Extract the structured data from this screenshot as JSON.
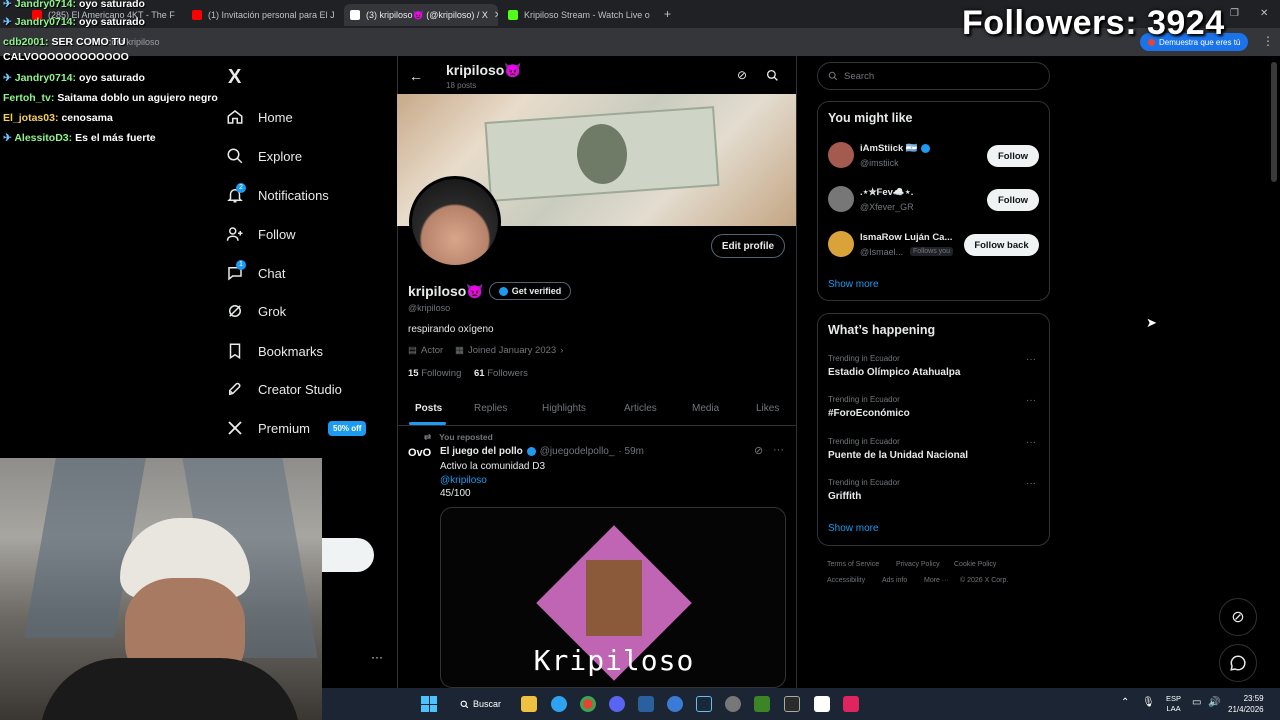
{
  "overlay": {
    "followers_text": "Followers: 3924"
  },
  "browser": {
    "tabs": [
      {
        "label": "(285) El Americano 4KT - The F",
        "color": "#ff0000"
      },
      {
        "label": "(1) Invitación personal para El J",
        "color": "#ff0000"
      },
      {
        "label": "(3) kripiloso👿 (@kripiloso) / X",
        "color": "#ffffff"
      },
      {
        "label": "Kripiloso Stream - Watch Live o",
        "color": "#53fc18"
      }
    ],
    "url": "x.com/kripiloso",
    "verify_label": "Demuestra que eres tú"
  },
  "chat": [
    {
      "user": "Jandry0714:",
      "msg": "oyo saturado",
      "color": "#8ef58a",
      "badge": true
    },
    {
      "user": "Jandry0714:",
      "msg": "oyo saturado",
      "color": "#8ef58a",
      "badge": true
    },
    {
      "user": "cdb2001:",
      "msg": "SER COMO TU",
      "color": "#8ef58a",
      "badge": false
    },
    {
      "user": "",
      "msg": "CALVOOOOOOOOOOOO",
      "color": "#ffffff",
      "badge": false
    },
    {
      "user": "Jandry0714:",
      "msg": "oyo saturado",
      "color": "#8ef58a",
      "badge": true
    },
    {
      "user": "Fertoh_tv:",
      "msg": "Saitama doblo un agujero negro",
      "color": "#8ef58a",
      "badge": false
    },
    {
      "user": "El_jotas03:",
      "msg": "cenosama",
      "color": "#f5d05a",
      "badge": false
    },
    {
      "user": "AlessitoD3:",
      "msg": "Es el más fuerte",
      "color": "#8ef58a",
      "badge": true
    }
  ],
  "sidebar": {
    "logo": "X",
    "items": [
      {
        "label": "Home",
        "icon": "home-icon"
      },
      {
        "label": "Explore",
        "icon": "search-icon"
      },
      {
        "label": "Notifications",
        "icon": "bell-icon",
        "badge": "2"
      },
      {
        "label": "Follow",
        "icon": "person-add-icon"
      },
      {
        "label": "Chat",
        "icon": "chat-icon",
        "badge": "1"
      },
      {
        "label": "Grok",
        "icon": "grok-icon"
      },
      {
        "label": "Bookmarks",
        "icon": "bookmark-icon"
      },
      {
        "label": "Creator Studio",
        "icon": "rocket-icon"
      },
      {
        "label": "Premium",
        "icon": "x-icon",
        "badge": "50% off"
      }
    ]
  },
  "profile": {
    "header_name": "kripiloso👿",
    "header_posts": "18 posts",
    "name": "kripiloso👿",
    "get_verified": "Get verified",
    "handle": "@kripiloso",
    "bio": "respirando oxígeno",
    "category": "Actor",
    "joined": "Joined January 2023",
    "following_count": "15",
    "following_label": "Following",
    "followers_count": "61",
    "followers_label": "Followers",
    "edit_profile": "Edit profile",
    "tabs": [
      "Posts",
      "Replies",
      "Highlights",
      "Articles",
      "Media",
      "Likes"
    ]
  },
  "post": {
    "repost_label": "You reposted",
    "author": "El juego del pollo",
    "handle": "@juegodelpollo_",
    "time": "· 59m",
    "text1": "Activo la comunidad D3",
    "mention": "@kripiloso",
    "text2": "45/100",
    "image_caption": "Kripiloso"
  },
  "right": {
    "search_placeholder": "Search",
    "might_like_title": "You might like",
    "suggestions": [
      {
        "name": "iAmStiick 🇦🇷",
        "handle": "@imstiick",
        "button": "Follow",
        "follows_you": ""
      },
      {
        "name": ".⋆✮Fev☁️⋆.",
        "handle": "@Xfever_GR",
        "button": "Follow",
        "follows_you": ""
      },
      {
        "name": "IsmaRow Luján Ca...",
        "handle": "@Ismael...",
        "button": "Follow back",
        "follows_you": "Follows you"
      }
    ],
    "show_more": "Show more",
    "happening_title": "What’s happening",
    "trends": [
      {
        "meta": "Trending in Ecuador",
        "name": "Estadio Olímpico Atahualpa"
      },
      {
        "meta": "Trending in Ecuador",
        "name": "#ForoEconómico"
      },
      {
        "meta": "Trending in Ecuador",
        "name": "Puente de la Unidad Nacional"
      },
      {
        "meta": "Trending in Ecuador",
        "name": "Griffith"
      }
    ],
    "show_more_2": "Show more",
    "footer": [
      "Terms of Service",
      "Privacy Policy",
      "Cookie Policy",
      "Accessibility",
      "Ads info",
      "More ···",
      "© 2026 X Corp."
    ]
  },
  "taskbar": {
    "search_label": "Buscar",
    "lang": "ESP",
    "lang2": "LAA",
    "time": "23:59",
    "date": "21/4/2026"
  }
}
